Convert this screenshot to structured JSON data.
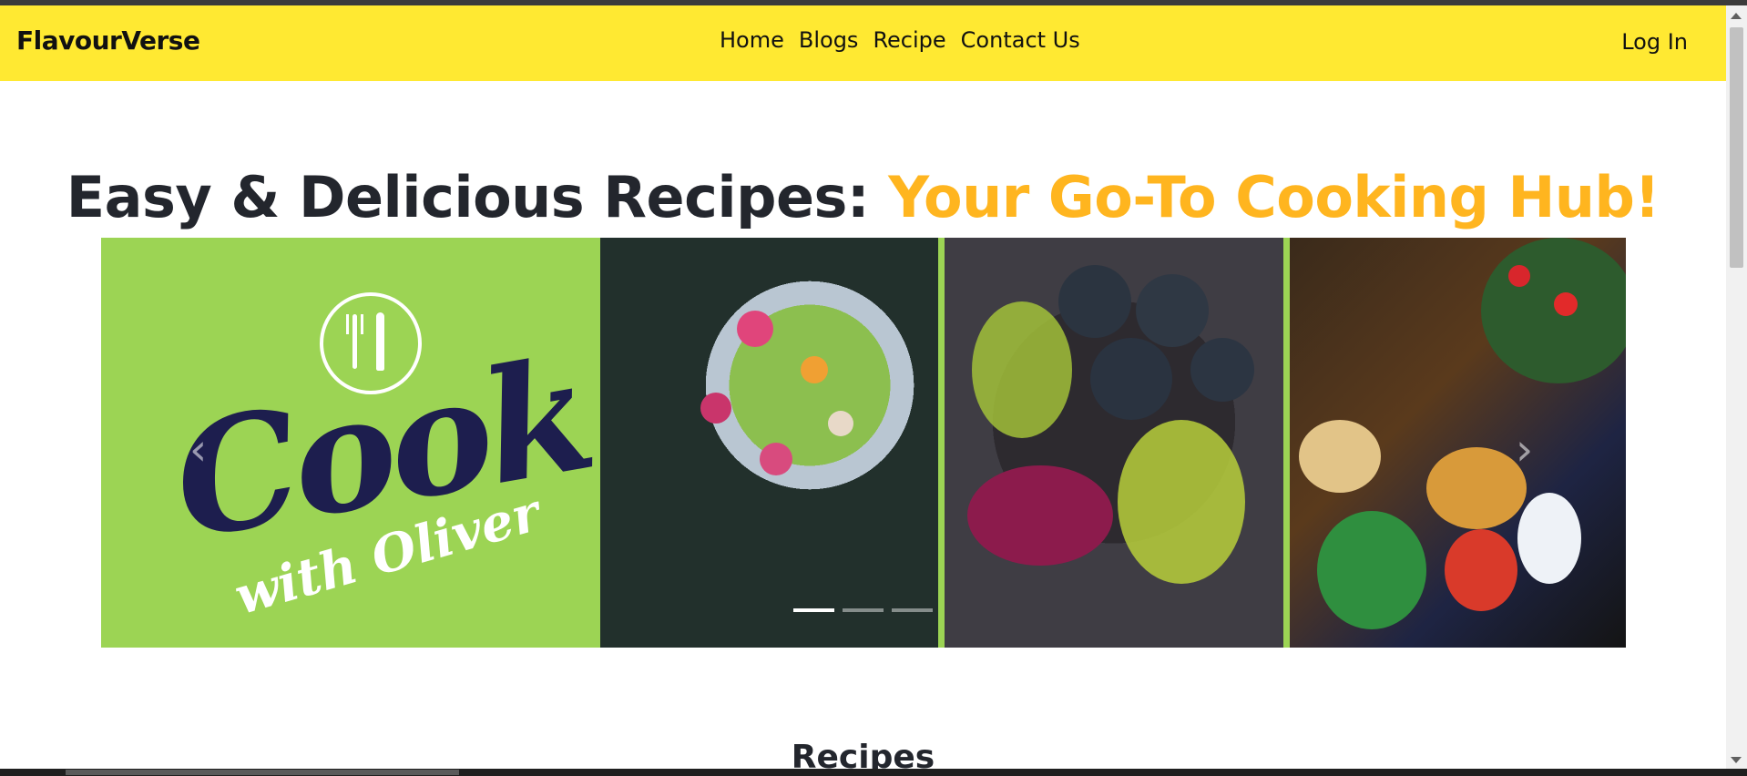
{
  "brand": "FlavourVerse",
  "nav": {
    "items": [
      "Home",
      "Blogs",
      "Recipe",
      "Contact Us"
    ],
    "login": "Log In"
  },
  "hero": {
    "title_main": "Easy & Delicious Recipes: ",
    "title_accent": "Your Go-To Cooking Hub!",
    "accent_color": "#ffb51f"
  },
  "carousel": {
    "logo_main": "Cook",
    "logo_sub": "with Oliver",
    "active_index": 0,
    "indicator_count": 3
  },
  "sections": {
    "recipes_title": "Recipes"
  },
  "colors": {
    "navbar": "#ffe932",
    "logo_background": "#9cd454",
    "logo_text": "#1d1e4e"
  }
}
